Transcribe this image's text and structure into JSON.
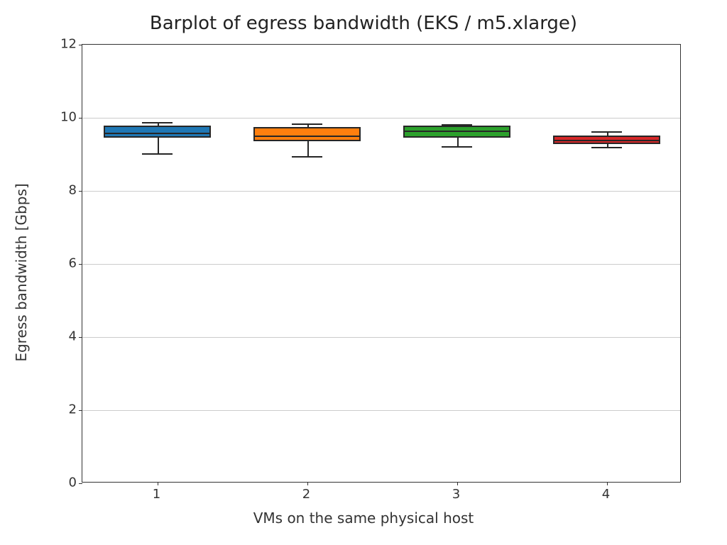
{
  "chart_data": {
    "type": "boxplot",
    "title": "Barplot of egress bandwidth (EKS / m5.xlarge)",
    "xlabel": "VMs on the same physical host",
    "ylabel": "Egress bandwidth [Gbps]",
    "ylim": [
      0,
      12
    ],
    "yticks": [
      0,
      2,
      4,
      6,
      8,
      10,
      12
    ],
    "categories": [
      "1",
      "2",
      "3",
      "4"
    ],
    "series": [
      {
        "name": "1",
        "q1": 9.45,
        "median": 9.6,
        "q3": 9.78,
        "whisker_low": 9.02,
        "whisker_high": 9.88,
        "color": "#1f77b4"
      },
      {
        "name": "2",
        "q1": 9.35,
        "median": 9.52,
        "q3": 9.75,
        "whisker_low": 8.95,
        "whisker_high": 9.85,
        "color": "#ff7f0e"
      },
      {
        "name": "3",
        "q1": 9.45,
        "median": 9.65,
        "q3": 9.78,
        "whisker_low": 9.22,
        "whisker_high": 9.83,
        "color": "#2ca02c"
      },
      {
        "name": "4",
        "q1": 9.28,
        "median": 9.4,
        "q3": 9.52,
        "whisker_low": 9.2,
        "whisker_high": 9.63,
        "color": "#d62728"
      }
    ],
    "grid": {
      "y": true,
      "x": false
    },
    "legend": null
  }
}
